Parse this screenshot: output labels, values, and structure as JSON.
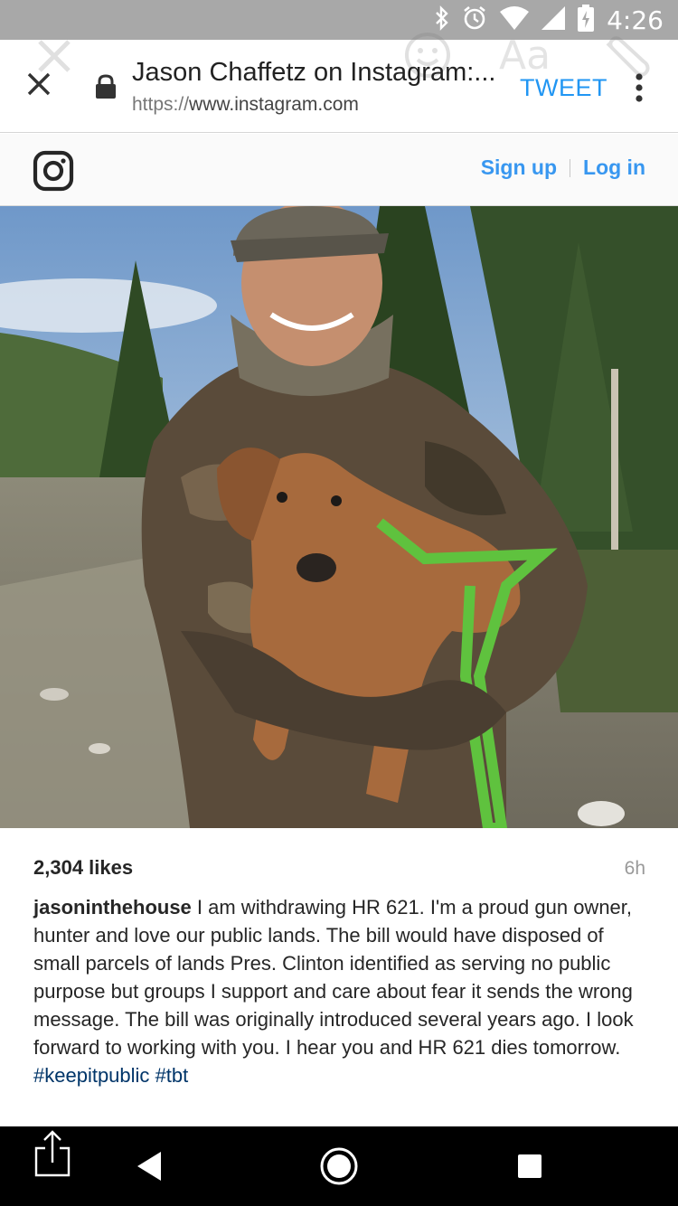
{
  "status_bar": {
    "time": "4:26",
    "icons": [
      "bluetooth-icon",
      "alarm-icon",
      "wifi-icon",
      "signal-icon",
      "battery-charging-icon"
    ]
  },
  "browser": {
    "page_title": "Jason Chaffetz on Instagram:...",
    "url_scheme": "https://",
    "url_host": "www.instagram.com",
    "tweet_label": "TWEET",
    "ghost_aa_label": "Aa"
  },
  "instagram": {
    "signup_label": "Sign up",
    "login_label": "Log in"
  },
  "post": {
    "likes": "2,304 likes",
    "time_ago": "6h",
    "username": "jasoninthehouse",
    "caption": " I am withdrawing HR 621. I'm a proud gun owner, hunter and love our public lands. The bill would have disposed of small parcels of lands Pres. Clinton identified as serving no public purpose but groups I support and care about fear it sends the wrong message. The bill was originally introduced several years ago. I look forward to working with you. I hear you and HR 621 dies tomorrow. ",
    "hashtags": [
      "#keepitpublic",
      "#tbt"
    ]
  },
  "colors": {
    "link_blue": "#3897f0",
    "tweet_blue": "#2196f3",
    "hashtag_blue": "#003569",
    "status_bar_gray": "#a8a8a8"
  }
}
